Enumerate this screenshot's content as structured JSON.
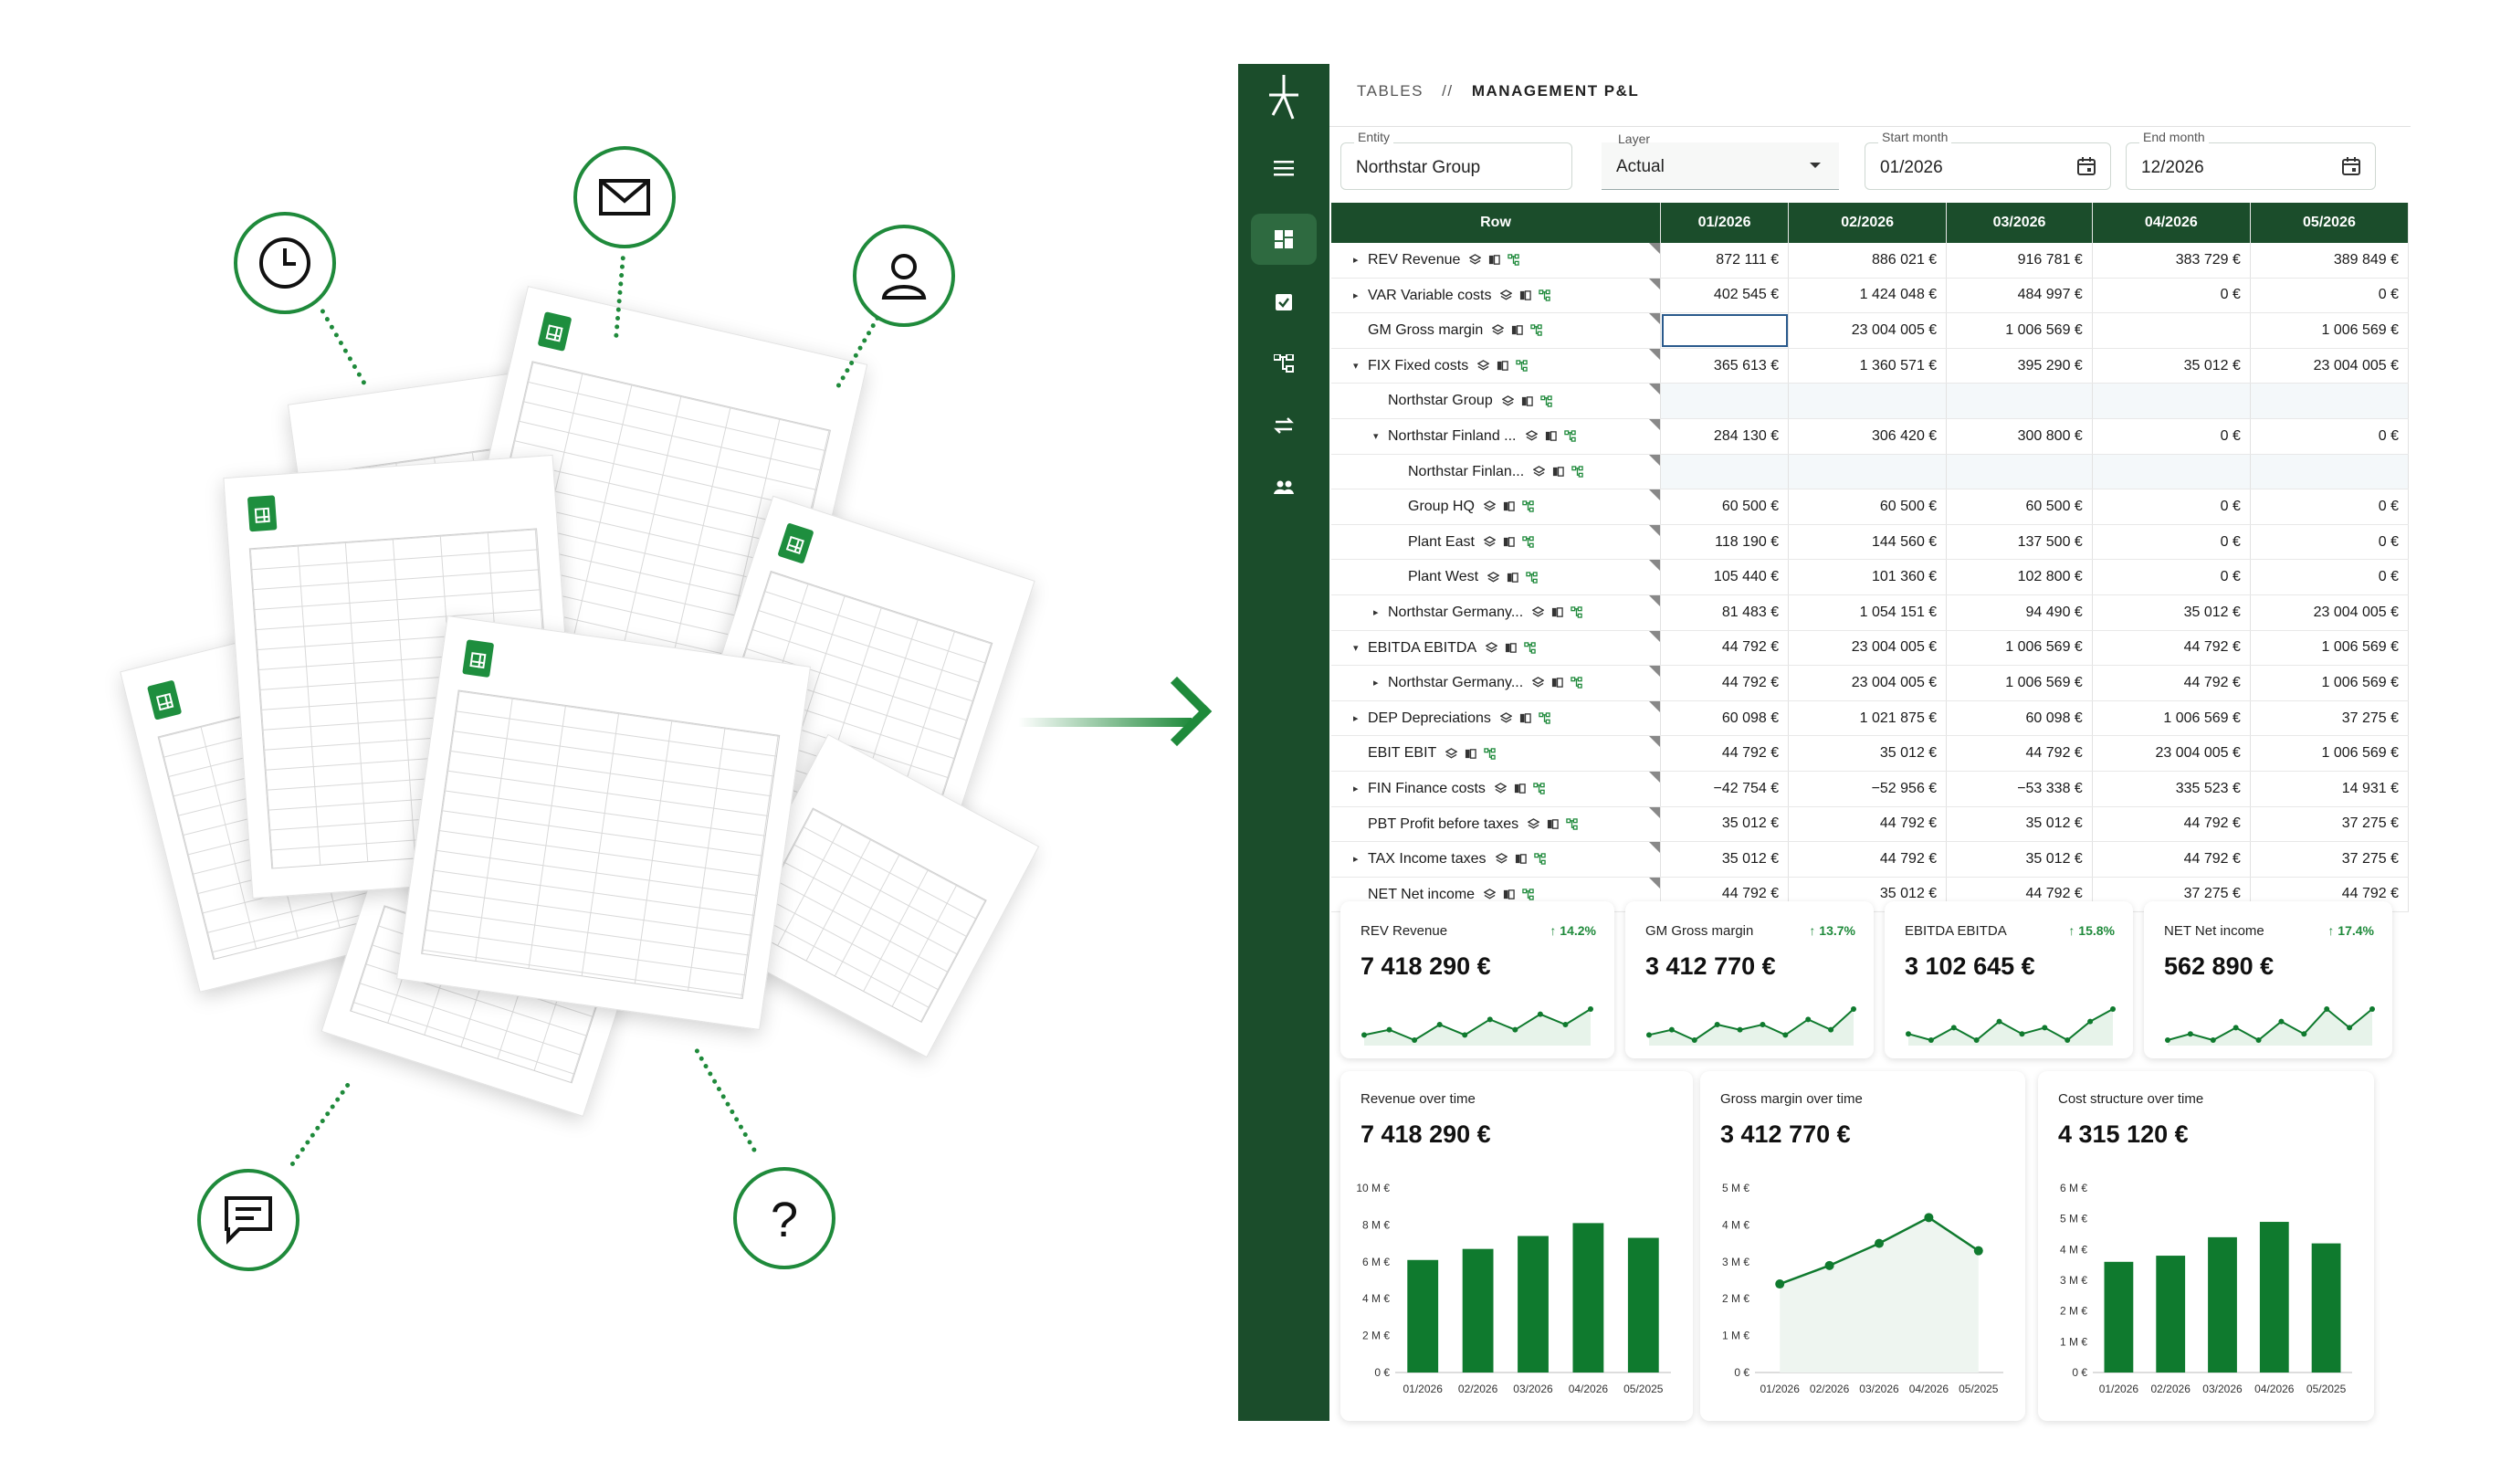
{
  "breadcrumb": {
    "section": "TABLES",
    "separator": "//",
    "page": "MANAGEMENT P&L"
  },
  "filters": {
    "entity": {
      "label": "Entity",
      "value": "Northstar Group"
    },
    "layer": {
      "label": "Layer",
      "value": "Actual"
    },
    "start": {
      "label": "Start month",
      "value": "01/2026"
    },
    "end": {
      "label": "End month",
      "value": "12/2026"
    }
  },
  "table": {
    "header_row": "Row",
    "columns": [
      "01/2026",
      "02/2026",
      "03/2026",
      "04/2026",
      "05/2026"
    ],
    "rows": [
      {
        "label": "REV Revenue",
        "caret": "▸",
        "indent": 0,
        "values": [
          "872 111 €",
          "886 021 €",
          "916 781 €",
          "383 729 €",
          "389 849 €"
        ]
      },
      {
        "label": "VAR Variable costs",
        "caret": "▸",
        "indent": 0,
        "values": [
          "402 545 €",
          "1 424 048 €",
          "484 997 €",
          "0 €",
          "0 €"
        ]
      },
      {
        "label": "GM Gross margin",
        "caret": "",
        "indent": 0,
        "values": [
          "",
          "23 004 005 €",
          "1 006 569 €",
          "",
          "1 006 569 €"
        ]
      },
      {
        "label": "FIX Fixed costs",
        "caret": "▾",
        "indent": 0,
        "values": [
          "365 613 €",
          "1 360 571 €",
          "395 290 €",
          "35 012 €",
          "23 004 005 €"
        ]
      },
      {
        "label": "Northstar Group",
        "caret": "",
        "indent": 1,
        "values": [
          "",
          "",
          "",
          "",
          ""
        ]
      },
      {
        "label": "Northstar Finland ...",
        "caret": "▾",
        "indent": 1,
        "values": [
          "284 130 €",
          "306 420 €",
          "300 800 €",
          "0 €",
          "0 €"
        ]
      },
      {
        "label": "Northstar Finlan...",
        "caret": "",
        "indent": 2,
        "values": [
          "",
          "",
          "",
          "",
          ""
        ]
      },
      {
        "label": "Group HQ",
        "caret": "",
        "indent": 2,
        "values": [
          "60 500 €",
          "60 500 €",
          "60 500 €",
          "0 €",
          "0 €"
        ]
      },
      {
        "label": "Plant East",
        "caret": "",
        "indent": 2,
        "values": [
          "118 190 €",
          "144 560 €",
          "137 500 €",
          "0 €",
          "0 €"
        ]
      },
      {
        "label": "Plant West",
        "caret": "",
        "indent": 2,
        "values": [
          "105 440 €",
          "101 360 €",
          "102 800 €",
          "0 €",
          "0 €"
        ]
      },
      {
        "label": "Northstar Germany...",
        "caret": "▸",
        "indent": 1,
        "values": [
          "81 483 €",
          "1 054 151 €",
          "94 490 €",
          "35 012 €",
          "23 004 005 €"
        ]
      },
      {
        "label": "EBITDA EBITDA",
        "caret": "▾",
        "indent": 0,
        "values": [
          "44 792 €",
          "23 004 005 €",
          "1 006 569 €",
          "44 792 €",
          "1 006 569 €"
        ]
      },
      {
        "label": "Northstar Germany...",
        "caret": "▸",
        "indent": 1,
        "values": [
          "44 792 €",
          "23 004 005 €",
          "1 006 569 €",
          "44 792 €",
          "1 006 569 €"
        ]
      },
      {
        "label": "DEP Depreciations",
        "caret": "▸",
        "indent": 0,
        "values": [
          "60 098 €",
          "1 021 875 €",
          "60 098 €",
          "1 006 569 €",
          "37 275 €"
        ]
      },
      {
        "label": "EBIT EBIT",
        "caret": "",
        "indent": 0,
        "values": [
          "44 792 €",
          "35 012 €",
          "44 792 €",
          "23 004 005 €",
          "1 006 569 €"
        ]
      },
      {
        "label": "FIN Finance costs",
        "caret": "▸",
        "indent": 0,
        "values": [
          "−42 754 €",
          "−52 956 €",
          "−53 338 €",
          "335 523 €",
          "14 931 €"
        ]
      },
      {
        "label": "PBT Profit before taxes",
        "caret": "",
        "indent": 0,
        "values": [
          "35 012 €",
          "44 792 €",
          "35 012 €",
          "44 792 €",
          "37 275 €"
        ]
      },
      {
        "label": "TAX Income taxes",
        "caret": "▸",
        "indent": 0,
        "values": [
          "35 012 €",
          "44 792 €",
          "35 012 €",
          "44 792 €",
          "37 275 €"
        ]
      },
      {
        "label": "NET Net income",
        "caret": "",
        "indent": 0,
        "values": [
          "44 792 €",
          "35 012 €",
          "44 792 €",
          "37 275 €",
          "44 792 €"
        ]
      }
    ]
  },
  "kpis": [
    {
      "title": "REV Revenue",
      "delta": "↑ 14.2%",
      "value": "7 418 290 €",
      "trend": [
        3,
        4,
        2,
        5,
        3,
        6,
        4,
        7,
        5,
        8
      ]
    },
    {
      "title": "GM Gross margin",
      "delta": "↑ 13.7%",
      "value": "3 412 770 €",
      "trend": [
        3,
        4,
        2,
        5,
        4,
        5,
        3,
        6,
        4,
        8
      ]
    },
    {
      "title": "EBITDA EBITDA",
      "delta": "↑ 15.8%",
      "value": "3 102 645 €",
      "trend": [
        4,
        3,
        5,
        3,
        6,
        4,
        5,
        3,
        6,
        8
      ]
    },
    {
      "title": "NET Net income",
      "delta": "↑ 17.4%",
      "value": "562 890 €",
      "trend": [
        3,
        4,
        3,
        5,
        3,
        6,
        4,
        8,
        5,
        8
      ]
    }
  ],
  "charts": [
    {
      "title": "Revenue over time",
      "value": "7 418 290 €",
      "chart_data": {
        "type": "bar",
        "categories": [
          "01/2026",
          "02/2026",
          "03/2026",
          "04/2026",
          "05/2025"
        ],
        "values": [
          6.1,
          6.7,
          7.4,
          8.1,
          7.3
        ],
        "ylim": [
          0,
          10
        ],
        "yticks": [
          "0 €",
          "2 M €",
          "4 M €",
          "6 M €",
          "8 M €",
          "10 M €"
        ],
        "tickvals": [
          0,
          2,
          4,
          6,
          8,
          10
        ]
      }
    },
    {
      "title": "Gross margin over time",
      "value": "3 412 770 €",
      "chart_data": {
        "type": "area",
        "categories": [
          "01/2026",
          "02/2026",
          "03/2026",
          "04/2026",
          "05/2025"
        ],
        "values": [
          2.4,
          2.9,
          3.5,
          4.2,
          3.3
        ],
        "ylim": [
          0,
          5
        ],
        "yticks": [
          "0 €",
          "1 M €",
          "2 M €",
          "3 M €",
          "4 M €",
          "5 M €"
        ],
        "tickvals": [
          0,
          1,
          2,
          3,
          4,
          5
        ]
      }
    },
    {
      "title": "Cost structure over time",
      "value": "4 315 120 €",
      "chart_data": {
        "type": "bar",
        "categories": [
          "01/2026",
          "02/2026",
          "03/2026",
          "04/2026",
          "05/2025"
        ],
        "values": [
          3.6,
          3.8,
          4.4,
          4.9,
          4.2
        ],
        "ylim": [
          0,
          6
        ],
        "yticks": [
          "0 €",
          "1 M €",
          "2 M €",
          "3 M €",
          "4 M €",
          "5 M €",
          "6 M €"
        ],
        "tickvals": [
          0,
          1,
          2,
          3,
          4,
          5,
          6
        ]
      }
    }
  ],
  "colors": {
    "brand": "#1b4d2b",
    "accent": "#1f8a3b",
    "bar": "#0f7a2e"
  },
  "icons": [
    "clock-icon",
    "mail-icon",
    "user-icon",
    "chat-icon",
    "question-icon",
    "spreadsheet-icon",
    "arrow-right-icon"
  ]
}
